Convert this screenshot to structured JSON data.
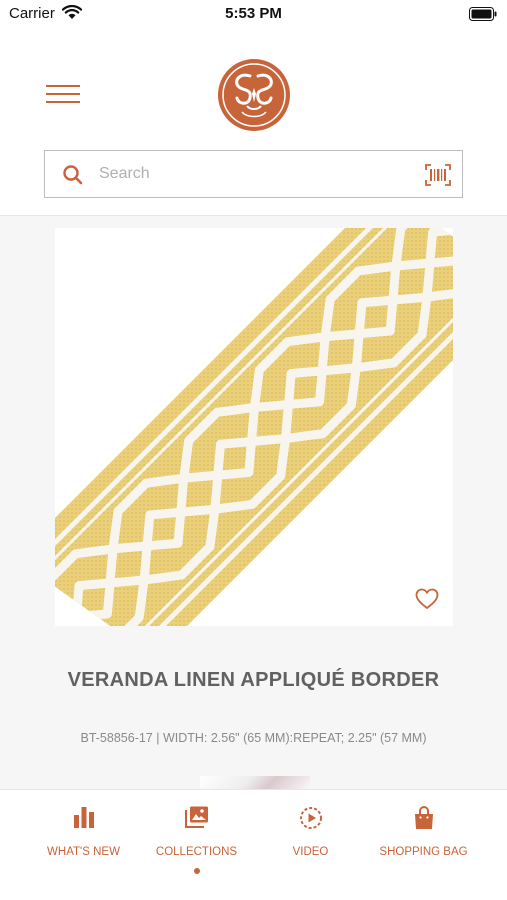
{
  "status_bar": {
    "carrier": "Carrier",
    "time": "5:53 PM"
  },
  "colors": {
    "accent": "#c8643a",
    "ribbon": "#ead07a",
    "pattern": "#f7f5ee"
  },
  "search": {
    "placeholder": "Search",
    "value": ""
  },
  "product": {
    "title": "VERANDA LINEN APPLIQUÉ  BORDER",
    "specs": "BT-58856-17 | WIDTH: 2.56\" (65 MM):REPEAT; 2.25\" (57 MM)"
  },
  "tabs": [
    {
      "label": "WHAT'S NEW",
      "icon": "bar-chart-icon"
    },
    {
      "label": "COLLECTIONS",
      "icon": "gallery-icon",
      "selected": true
    },
    {
      "label": "VIDEO",
      "icon": "play-icon"
    },
    {
      "label": "SHOPPING BAG",
      "icon": "bag-icon"
    }
  ]
}
